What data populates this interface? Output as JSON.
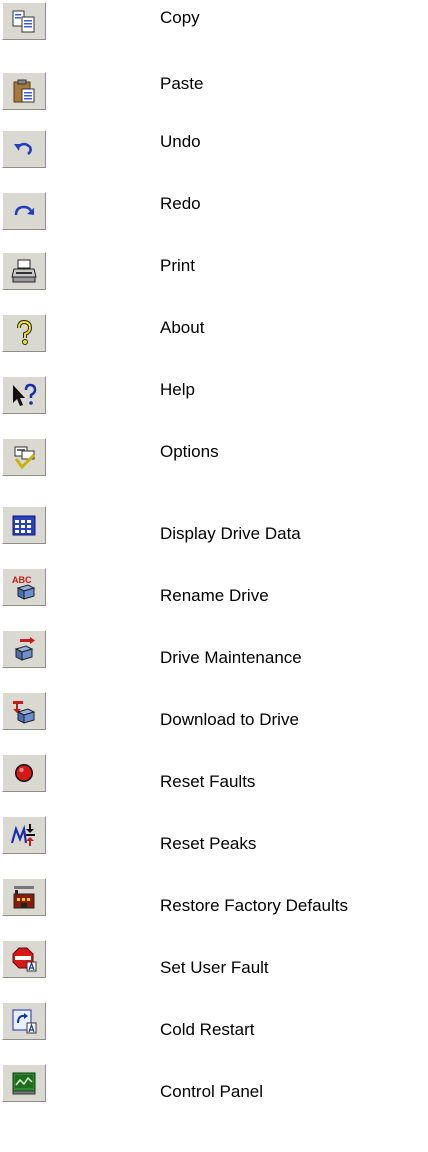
{
  "toolbar_buttons": [
    {
      "icon": "copy-icon",
      "label": "Copy"
    },
    {
      "icon": "paste-icon",
      "label": "Paste"
    },
    {
      "icon": "undo-icon",
      "label": "Undo"
    },
    {
      "icon": "redo-icon",
      "label": "Redo"
    },
    {
      "icon": "print-icon",
      "label": "Print"
    },
    {
      "icon": "about-icon",
      "label": "About"
    },
    {
      "icon": "help-icon",
      "label": "Help"
    },
    {
      "icon": "options-icon",
      "label": "Options"
    },
    {
      "icon": "display-drive-data-icon",
      "label": "Display Drive Data"
    },
    {
      "icon": "rename-drive-icon",
      "label": "Rename Drive"
    },
    {
      "icon": "drive-maintenance-icon",
      "label": "Drive Maintenance"
    },
    {
      "icon": "download-to-drive-icon",
      "label": "Download to Drive"
    },
    {
      "icon": "reset-faults-icon",
      "label": "Reset Faults"
    },
    {
      "icon": "reset-peaks-icon",
      "label": "Reset Peaks"
    },
    {
      "icon": "restore-factory-defaults-icon",
      "label": "Restore Factory Defaults"
    },
    {
      "icon": "set-user-fault-icon",
      "label": "Set User Fault"
    },
    {
      "icon": "cold-restart-icon",
      "label": "Cold Restart"
    },
    {
      "icon": "control-panel-icon",
      "label": "Control Panel"
    }
  ]
}
